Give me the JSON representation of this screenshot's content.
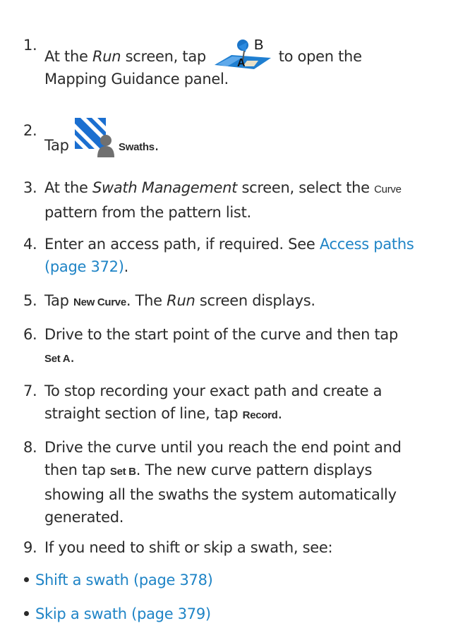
{
  "steps": [
    {
      "num": "1.",
      "a": "At the ",
      "b": "Run",
      "c": " screen, tap ",
      "d": " to open the",
      "line2": "Mapping Guidance panel.",
      "icon": "mapping-guidance-ab-icon",
      "icon_letter_a": "A",
      "icon_letter_b": "B"
    },
    {
      "num": "2.",
      "a": "Tap ",
      "ui": "Swaths",
      "end": ".",
      "icon": "swaths-icon"
    },
    {
      "num": "3.",
      "a": "At the ",
      "b": "Swath Management",
      "c": " screen, select the ",
      "ui": "Curve",
      "line2": "pattern from the pattern list."
    },
    {
      "num": "4.",
      "a": "Enter an access path, if required. See ",
      "link1": "Access paths",
      "link2": "(page 372)",
      "end": "."
    },
    {
      "num": "5.",
      "a": "Tap ",
      "ui": "New Curve",
      "b": ". The ",
      "c": "Run",
      "d": " screen displays."
    },
    {
      "num": "6.",
      "a": "Drive to the start point of the curve and then tap",
      "ui": "Set A",
      "end": "."
    },
    {
      "num": "7.",
      "a": "To stop recording your exact path and create a",
      "b": "straight section of line, tap ",
      "ui": "Record",
      "end": "."
    },
    {
      "num": "8.",
      "a": "Drive the curve until you reach the end point and",
      "b": "then tap ",
      "ui": "Set B",
      "c": ". The new curve pattern displays",
      "d": "showing all the swaths the system automatically",
      "e": "generated."
    },
    {
      "num": "9.",
      "a": "If you need to shift or skip a swath, see:"
    }
  ],
  "bullets": [
    {
      "label": "Shift a swath (page 378)"
    },
    {
      "label": "Skip a swath (page 379)"
    }
  ],
  "colors": {
    "link": "#1f84c6",
    "text": "#2b2b2b",
    "icon_blue": "#1f7fd1"
  }
}
